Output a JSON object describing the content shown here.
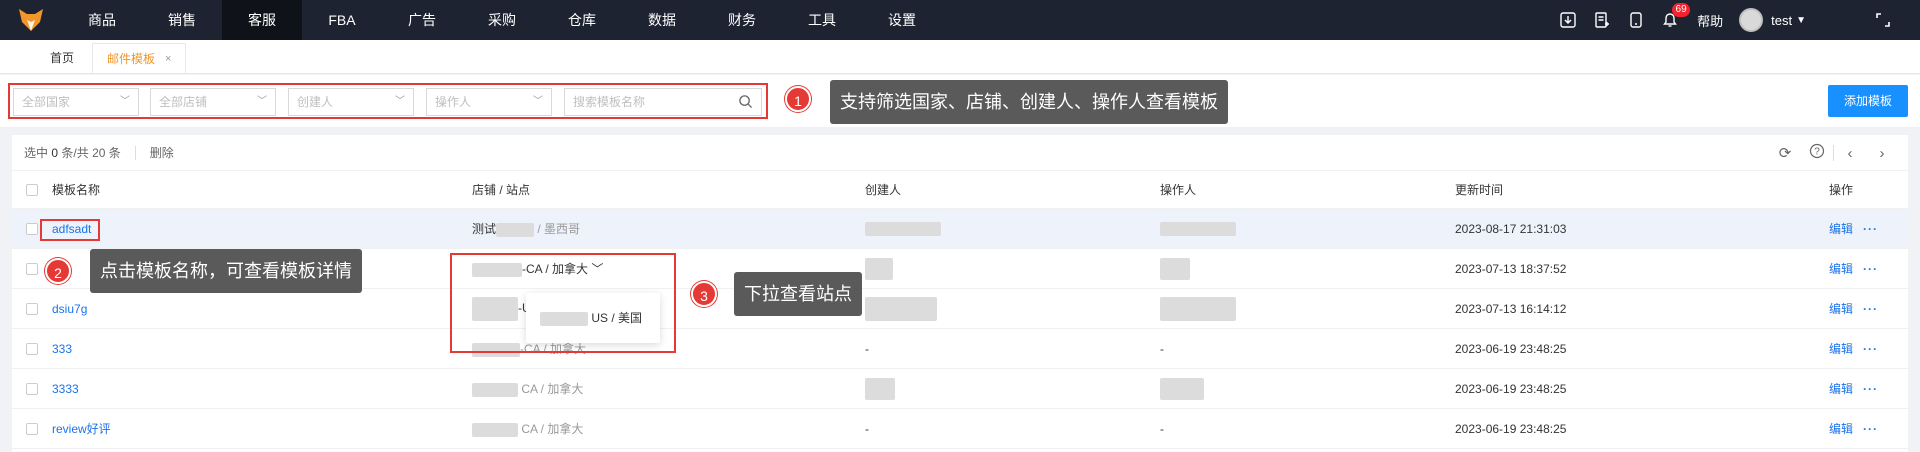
{
  "nav": {
    "items": [
      "商品",
      "销售",
      "客服",
      "FBA",
      "广告",
      "采购",
      "仓库",
      "数据",
      "财务",
      "工具",
      "设置"
    ],
    "active": "客服",
    "notification_count": "69",
    "help": "帮助",
    "username": "test"
  },
  "tabs": {
    "home": "首页",
    "current": "邮件模板",
    "close": "×"
  },
  "filters": {
    "country": "全部国家",
    "shop": "全部店铺",
    "creator": "创建人",
    "operator": "操作人",
    "search_placeholder": "搜索模板名称",
    "add_button": "添加模板"
  },
  "callouts": {
    "c1": {
      "num": "1",
      "text": "支持筛选国家、店铺、创建人、操作人查看模板"
    },
    "c2": {
      "num": "2",
      "text": "点击模板名称，可查看模板详情"
    },
    "c3": {
      "num": "3",
      "text": "下拉查看站点"
    }
  },
  "toolbar": {
    "selected_prefix": "选中",
    "selected_count": "0",
    "selected_mid": "条/共",
    "total": "20",
    "selected_suffix": "条",
    "delete": "删除"
  },
  "table": {
    "headers": {
      "name": "模板名称",
      "shop": "店铺 / 站点",
      "creator": "创建人",
      "operator": "操作人",
      "updated": "更新时间",
      "actions": "操作"
    },
    "edit_label": "编辑",
    "more_label": "···",
    "rows": [
      {
        "name": "adfsadt",
        "shop_prefix": "测试",
        "site": "墨西哥",
        "creator": "",
        "operator": "",
        "updated": "2023-08-17 21:31:03"
      },
      {
        "name": "",
        "shop_prefix": "",
        "site": "-CA / 加拿大",
        "creator": "",
        "operator": "",
        "updated": "2023-07-13 18:37:52"
      },
      {
        "name": "dsiu7g",
        "shop_prefix": "",
        "site": "-U",
        "creator": "",
        "operator": "",
        "updated": "2023-07-13 16:14:12"
      },
      {
        "name": "333",
        "shop_prefix": "",
        "site": "-CA / 加拿大",
        "creator": "-",
        "operator": "-",
        "updated": "2023-06-19 23:48:25"
      },
      {
        "name": "3333",
        "shop_prefix": "",
        "site": "CA / 加拿大",
        "creator": "",
        "operator": "",
        "updated": "2023-06-19 23:48:25"
      },
      {
        "name": "review好评",
        "shop_prefix": "",
        "site": "CA / 加拿大",
        "creator": "-",
        "operator": "-",
        "updated": "2023-06-19 23:48:25"
      }
    ]
  },
  "dropdown": {
    "option": "US / 美国"
  },
  "colors": {
    "nav_bg": "#1d2330",
    "accent": "#1890ff",
    "callout_red": "#e53935",
    "tab_active": "#f0962a"
  }
}
